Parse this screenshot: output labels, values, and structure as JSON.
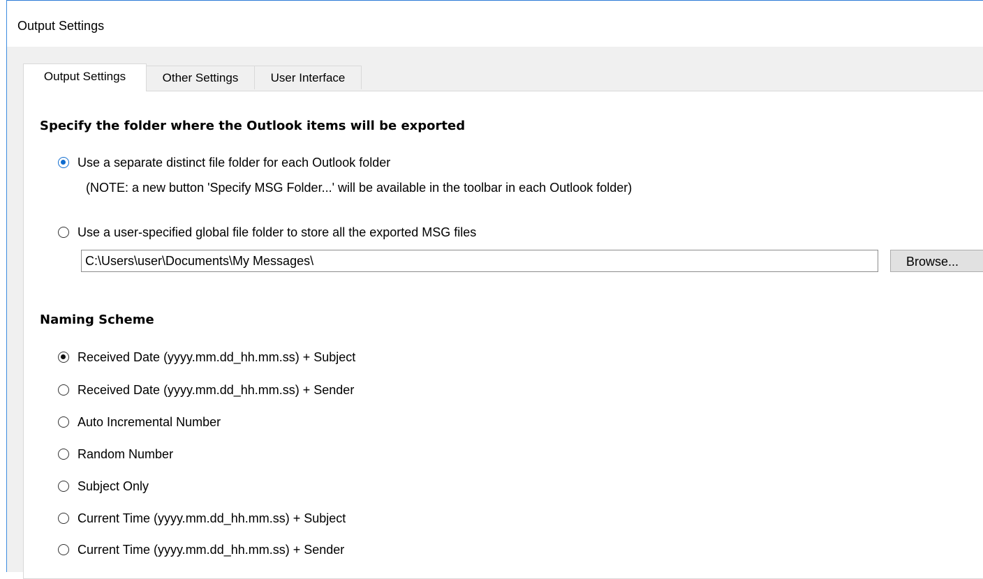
{
  "window": {
    "title": "Output Settings"
  },
  "tabs": [
    {
      "label": "Output Settings",
      "active": true
    },
    {
      "label": "Other Settings",
      "active": false
    },
    {
      "label": "User Interface",
      "active": false
    }
  ],
  "folder_section": {
    "heading": "Specify the folder where the Outlook items will be exported",
    "options": [
      {
        "label": "Use a separate distinct file folder for each Outlook folder",
        "checked": true
      },
      {
        "label": "Use a user-specified global file folder to store all the exported MSG files",
        "checked": false
      }
    ],
    "note": "(NOTE: a new button 'Specify MSG Folder...' will be available in the toolbar in each Outlook folder)",
    "path_value": "C:\\Users\\user\\Documents\\My Messages\\",
    "browse_label": "Browse..."
  },
  "naming_section": {
    "heading": "Naming Scheme",
    "options": [
      {
        "label": "Received Date (yyyy.mm.dd_hh.mm.ss) + Subject",
        "checked": true
      },
      {
        "label": "Received Date (yyyy.mm.dd_hh.mm.ss) + Sender",
        "checked": false
      },
      {
        "label": "Auto Incremental Number",
        "checked": false
      },
      {
        "label": "Random Number",
        "checked": false
      },
      {
        "label": "Subject Only",
        "checked": false
      },
      {
        "label": "Current Time (yyyy.mm.dd_hh.mm.ss) + Subject",
        "checked": false
      },
      {
        "label": "Current Time (yyyy.mm.dd_hh.mm.ss) + Sender",
        "checked": false
      }
    ]
  },
  "colors": {
    "accent": "#0f6ccf",
    "window_border": "#2b7ad6"
  }
}
